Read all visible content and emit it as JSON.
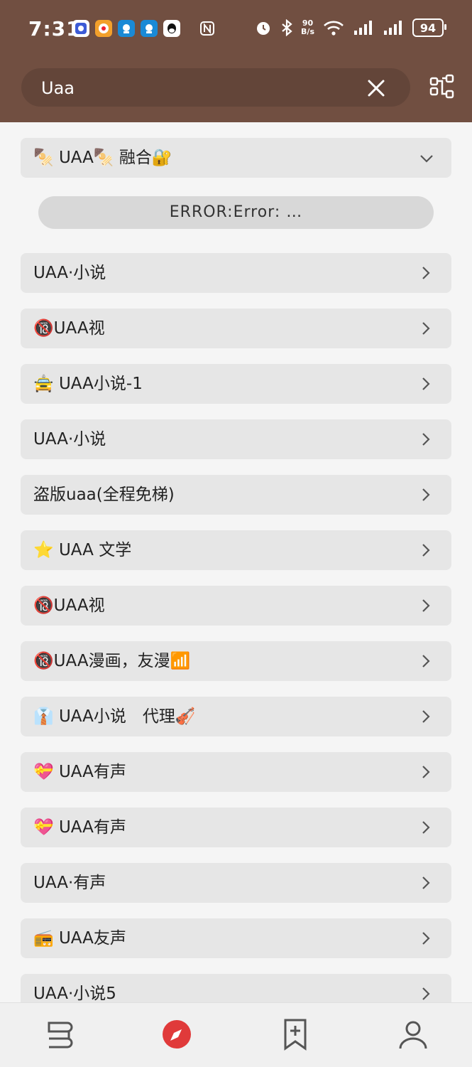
{
  "status": {
    "time": "7:31",
    "net_speed_value": "90",
    "net_speed_unit": "B/s",
    "battery": "94"
  },
  "search": {
    "value": "Uaa"
  },
  "group": {
    "title": "🍢 UAA🍢 融合🔐"
  },
  "error": {
    "text": "ERROR:Error: …"
  },
  "items": [
    {
      "label": "UAA·小说"
    },
    {
      "label": "🔞UAA视"
    },
    {
      "label": "🚖 UAA小说-1"
    },
    {
      "label": "UAA·小说"
    },
    {
      "label": "盗版uaa(全程免梯)"
    },
    {
      "label": "⭐ UAA 文学"
    },
    {
      "label": "🔞UAA视"
    },
    {
      "label": "🔞UAA漫画，友漫📶"
    },
    {
      "label": "👔 UAA小说　代理🎻"
    },
    {
      "label": "💝 UAA有声"
    },
    {
      "label": "💝 UAA有声"
    },
    {
      "label": "UAA·有声"
    },
    {
      "label": "📻 UAA友声"
    },
    {
      "label": "UAA·小说5"
    }
  ],
  "colors": {
    "header": "#714f41",
    "accent": "#e03a3a",
    "item_bg": "#e6e6e6"
  }
}
